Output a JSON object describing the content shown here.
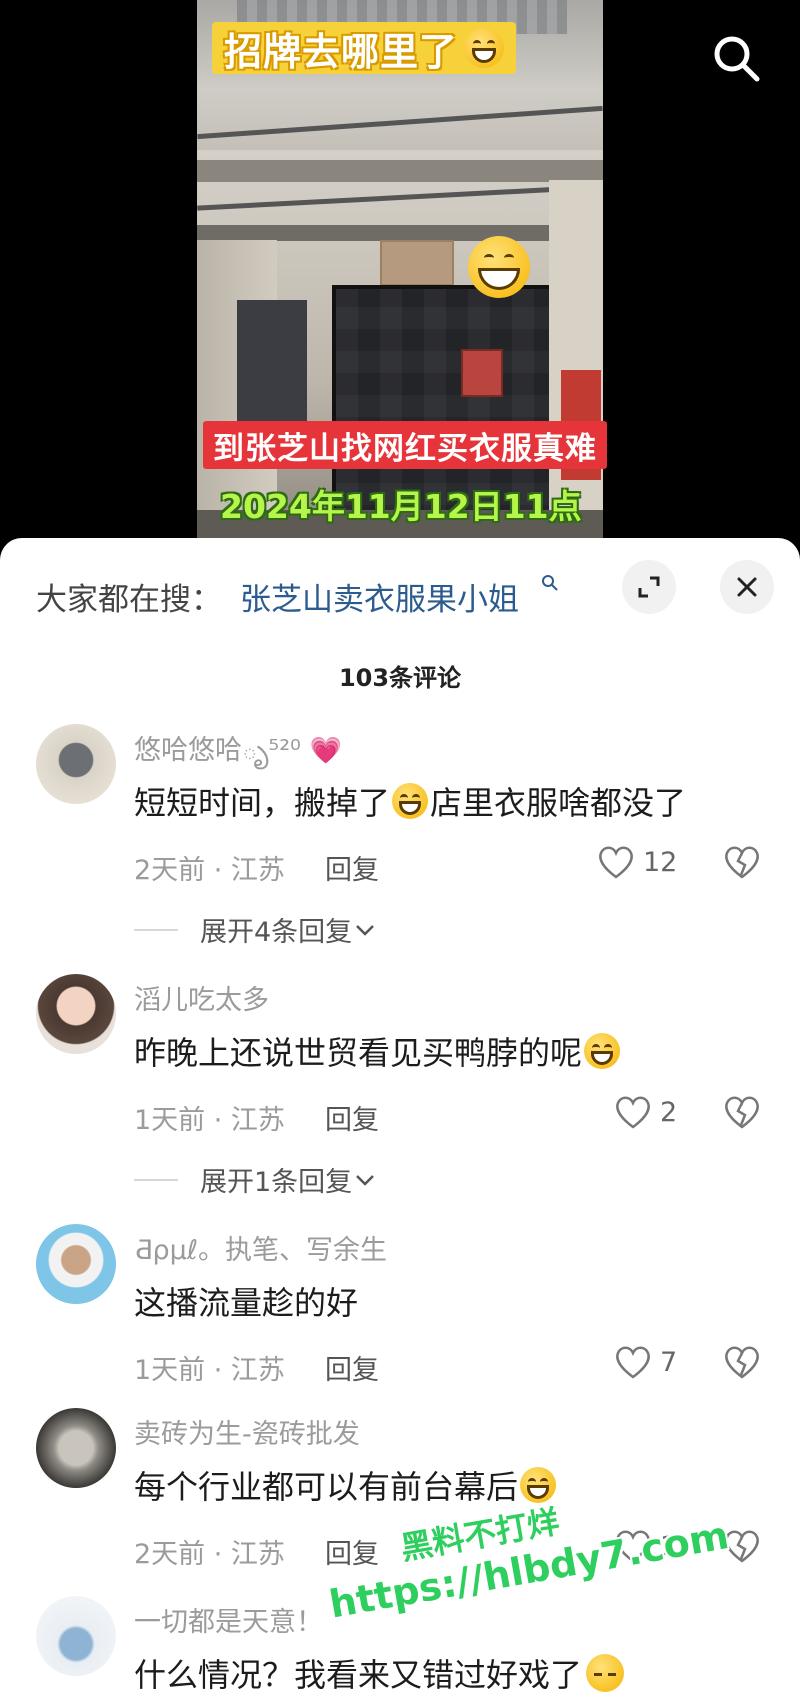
{
  "video": {
    "title_overlay": "招牌去哪里了",
    "caption_red": "到张芝山找网红买衣服真难",
    "caption_date": "2024年11月12日11点",
    "icons": {
      "title_emoji": "rolling-laughing-emoji",
      "big_emoji": "grinning-emoji",
      "search": "search-icon"
    }
  },
  "sheet": {
    "search_prefix": "大家都在搜：",
    "search_term": "张芝山卖衣服果小姐",
    "comment_count": "103条评论",
    "icons": {
      "expand": "expand-icon",
      "close": "close-icon"
    }
  },
  "comments": [
    {
      "user": "悠哈悠哈ృ⁵²⁰",
      "text_a": "短短时间，搬掉了",
      "text_b": "店里衣服啥都没了",
      "meta": "2天前 · 江苏",
      "reply": "回复",
      "likes": "12",
      "expand": "展开4条回复"
    },
    {
      "user": "滔儿吃太多",
      "text_a": "昨晚上还说世贸看见买鸭脖的呢",
      "text_b": "",
      "meta": "1天前 · 江苏",
      "reply": "回复",
      "likes": "2",
      "expand": "展开1条回复"
    },
    {
      "user": "Ƌρμℓ。执笔、写余生",
      "text_a": "这播流量趁的好",
      "text_b": "",
      "meta": "1天前 · 江苏",
      "reply": "回复",
      "likes": "7",
      "expand": ""
    },
    {
      "user": "卖砖为生-瓷砖批发",
      "text_a": "每个行业都可以有前台幕后",
      "text_b": "",
      "meta": "2天前 · 江苏",
      "reply": "回复",
      "likes": "1",
      "expand": ""
    },
    {
      "user": "一切都是天意！",
      "text_a": "什么情况？我看来又错过好戏了",
      "text_b": "",
      "meta": "",
      "reply": "",
      "likes": "",
      "expand": ""
    }
  ],
  "watermark": {
    "line1": "黑料不打烊",
    "line2": "https://hlbdy7.com"
  },
  "colors": {
    "accent_link": "#2c5b8f",
    "red_caption": "#e5343a",
    "date_green": "#b7f54a",
    "watermark": "#2ecf5e"
  }
}
